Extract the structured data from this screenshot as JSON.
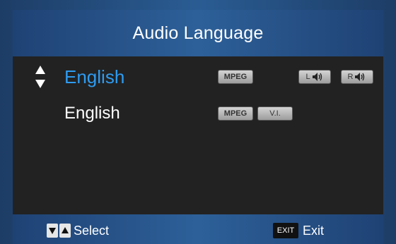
{
  "header": {
    "title": "Audio Language"
  },
  "tracks": [
    {
      "language": "English",
      "codec": "MPEG",
      "extra_badge": "",
      "channel_left": "L",
      "channel_right": "R",
      "selected": true
    },
    {
      "language": "English",
      "codec": "MPEG",
      "extra_badge": "V.I.",
      "selected": false
    }
  ],
  "footer": {
    "select_label": "Select",
    "exit_key": "EXIT",
    "exit_label": "Exit"
  },
  "icons": [
    "up-down-arrows-icon",
    "speaker-icon",
    "down-arrow-key-icon",
    "up-arrow-key-icon"
  ],
  "colors": {
    "selected_text": "#2e9bf0",
    "panel": "#222222",
    "bar": "#2a5c93"
  }
}
